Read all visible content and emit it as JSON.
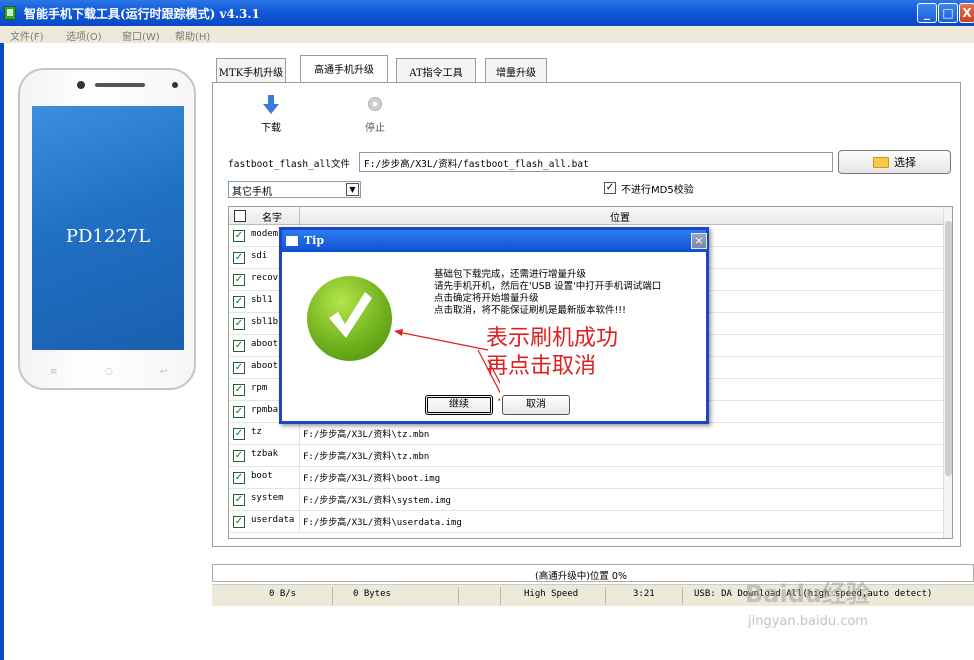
{
  "window": {
    "title": "智能手机下载工具(运行时跟踪模式)  v4.3.1",
    "min": "_",
    "max": "□",
    "close": "X"
  },
  "menu": [
    "文件(F)",
    "选项(O)",
    "窗口(W)",
    "帮助(H)"
  ],
  "phone": {
    "model": "PD1227L",
    "keys": [
      "≡",
      "○",
      "↩"
    ]
  },
  "tabs": [
    {
      "label": "MTK手机升级",
      "active": false
    },
    {
      "label": "高通手机升级",
      "active": true
    },
    {
      "label": "AT指令工具",
      "active": false
    },
    {
      "label": "增量升级",
      "active": false
    }
  ],
  "toolbar": {
    "download": "下载",
    "stop": "停止"
  },
  "file": {
    "label": "fastboot_flash_all文件",
    "value": "F:/步步高/X3L/资料/fastboot_flash_all.bat",
    "select_button": "选择"
  },
  "options": {
    "phone_select": "其它手机",
    "phone_select_arrow": "▼",
    "md5_check": "✓",
    "md5_label": "不进行MD5校验"
  },
  "table": {
    "headers": {
      "check": "",
      "name": "名字",
      "location": "位置"
    },
    "check_mark": "✓",
    "rows": [
      {
        "name": "modem",
        "path": ""
      },
      {
        "name": "sdi",
        "path": ""
      },
      {
        "name": "recov",
        "path": ""
      },
      {
        "name": "sbl1",
        "path": ""
      },
      {
        "name": "sbl1b",
        "path": ""
      },
      {
        "name": "aboot",
        "path": ""
      },
      {
        "name": "aboot",
        "path": ""
      },
      {
        "name": "rpm",
        "path": ""
      },
      {
        "name": "rpmba",
        "path": ""
      },
      {
        "name": "tz",
        "path": "F:/步步高/X3L/资料\\tz.mbn"
      },
      {
        "name": "tzbak",
        "path": "F:/步步高/X3L/资料\\tz.mbn"
      },
      {
        "name": "boot",
        "path": "F:/步步高/X3L/资料\\boot.img"
      },
      {
        "name": "system",
        "path": "F:/步步高/X3L/资料\\system.img"
      },
      {
        "name": "userdata",
        "path": "F:/步步高/X3L/资料\\userdata.img"
      }
    ]
  },
  "dialog": {
    "title": "Tip",
    "close": "×",
    "messages": [
      "基础包下载完成，还需进行增量升级",
      "请先手机开机，然后在'USB 设置'中打开手机调试端口",
      "点击确定将开始增量升级",
      "点击取消，将不能保证刷机是最新版本软件!!!"
    ],
    "continue_button": "继续",
    "cancel_button": "取消"
  },
  "annotation": {
    "line1": "表示刷机成功",
    "line2": "再点击取消",
    "color": "#e02020"
  },
  "status": {
    "progress_text": "(高通升级中)位置 0%",
    "speed": "0 B/s",
    "bytes": "0 Bytes",
    "mode": "High Speed",
    "time": "3:21",
    "usb": "USB: DA Download All(high speed,auto detect)"
  },
  "watermark": {
    "logo": "Baidu经验",
    "url": "jingyan.baidu.com"
  }
}
